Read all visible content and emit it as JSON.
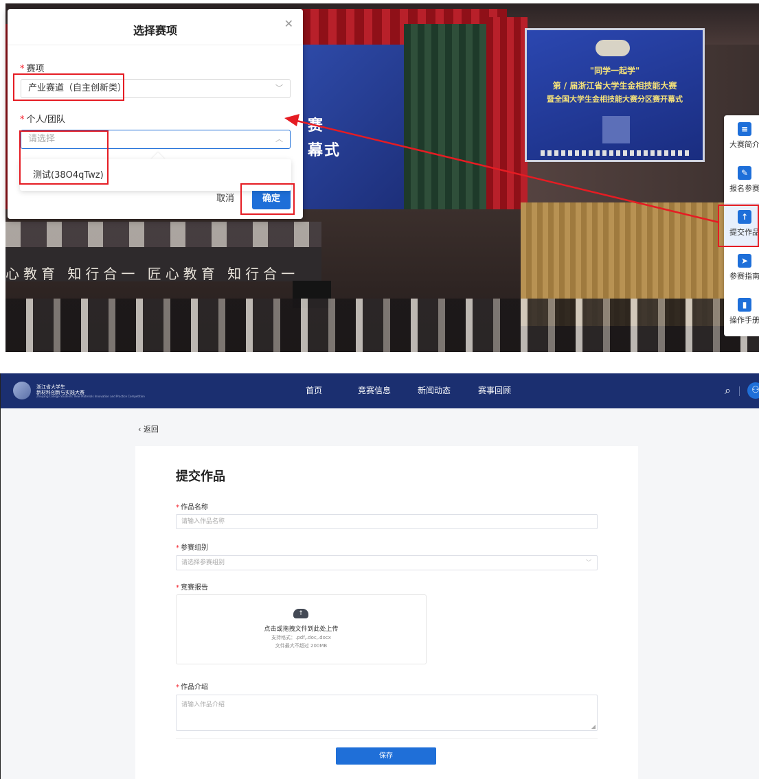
{
  "modal": {
    "title": "选择赛项",
    "close_glyph": "✕",
    "field1_label": "赛项",
    "field1_value": "产业赛道（自主创新类）",
    "field2_label": "个人/团队",
    "field2_placeholder": "请选择",
    "dropdown_options": [
      "测试(38O4qTwz)"
    ],
    "cancel_label": "取消",
    "ok_label": "确定"
  },
  "stage": {
    "screen_left_line1": "赛",
    "screen_left_line2": "幕式",
    "screen_right_line1": "\"同学一起学\"",
    "screen_right_line2": "第 / 届浙江省大学生金相技能大赛",
    "screen_right_line3": "暨全国大学生金相技能大赛分区赛开幕式",
    "banner": "心教育 知行合一 匠心教育 知行合一"
  },
  "float_sidebar": {
    "items": [
      {
        "label": "大赛简介",
        "icon": "doc-icon"
      },
      {
        "label": "报名参赛",
        "icon": "edit-icon"
      },
      {
        "label": "提交作品",
        "icon": "upload-icon"
      },
      {
        "label": "参赛指南",
        "icon": "send-icon"
      },
      {
        "label": "操作手册",
        "icon": "book-icon"
      }
    ]
  },
  "navbar": {
    "logo_line1": "浙江省大学生",
    "logo_line2": "新材料创新与实践大赛",
    "logo_line3": "Zhejiang College Students' New Materials Innovation and Practice Competition",
    "items": [
      "首页",
      "竞赛信息",
      "新闻动态",
      "赛事回顾"
    ],
    "search_icon": "search-icon",
    "avatar_icon": "user-icon"
  },
  "form": {
    "back_label": "返回",
    "title": "提交作品",
    "name_label": "作品名称",
    "name_placeholder": "请输入作品名称",
    "group_label": "参赛组别",
    "group_placeholder": "请选择参赛组别",
    "report_label": "竞赛报告",
    "upload_main": "点击或拖拽文件到此处上传",
    "upload_formats": "支持格式：.pdf,.doc,.docx",
    "upload_size": "文件最大不超过 200MB",
    "intro_label": "作品介绍",
    "intro_placeholder": "请输入作品介绍",
    "save_label": "保存"
  },
  "colors": {
    "accent": "#1f6fd8",
    "navbar": "#1b2f70",
    "highlight": "#e51c23",
    "required": "#f5222d"
  }
}
